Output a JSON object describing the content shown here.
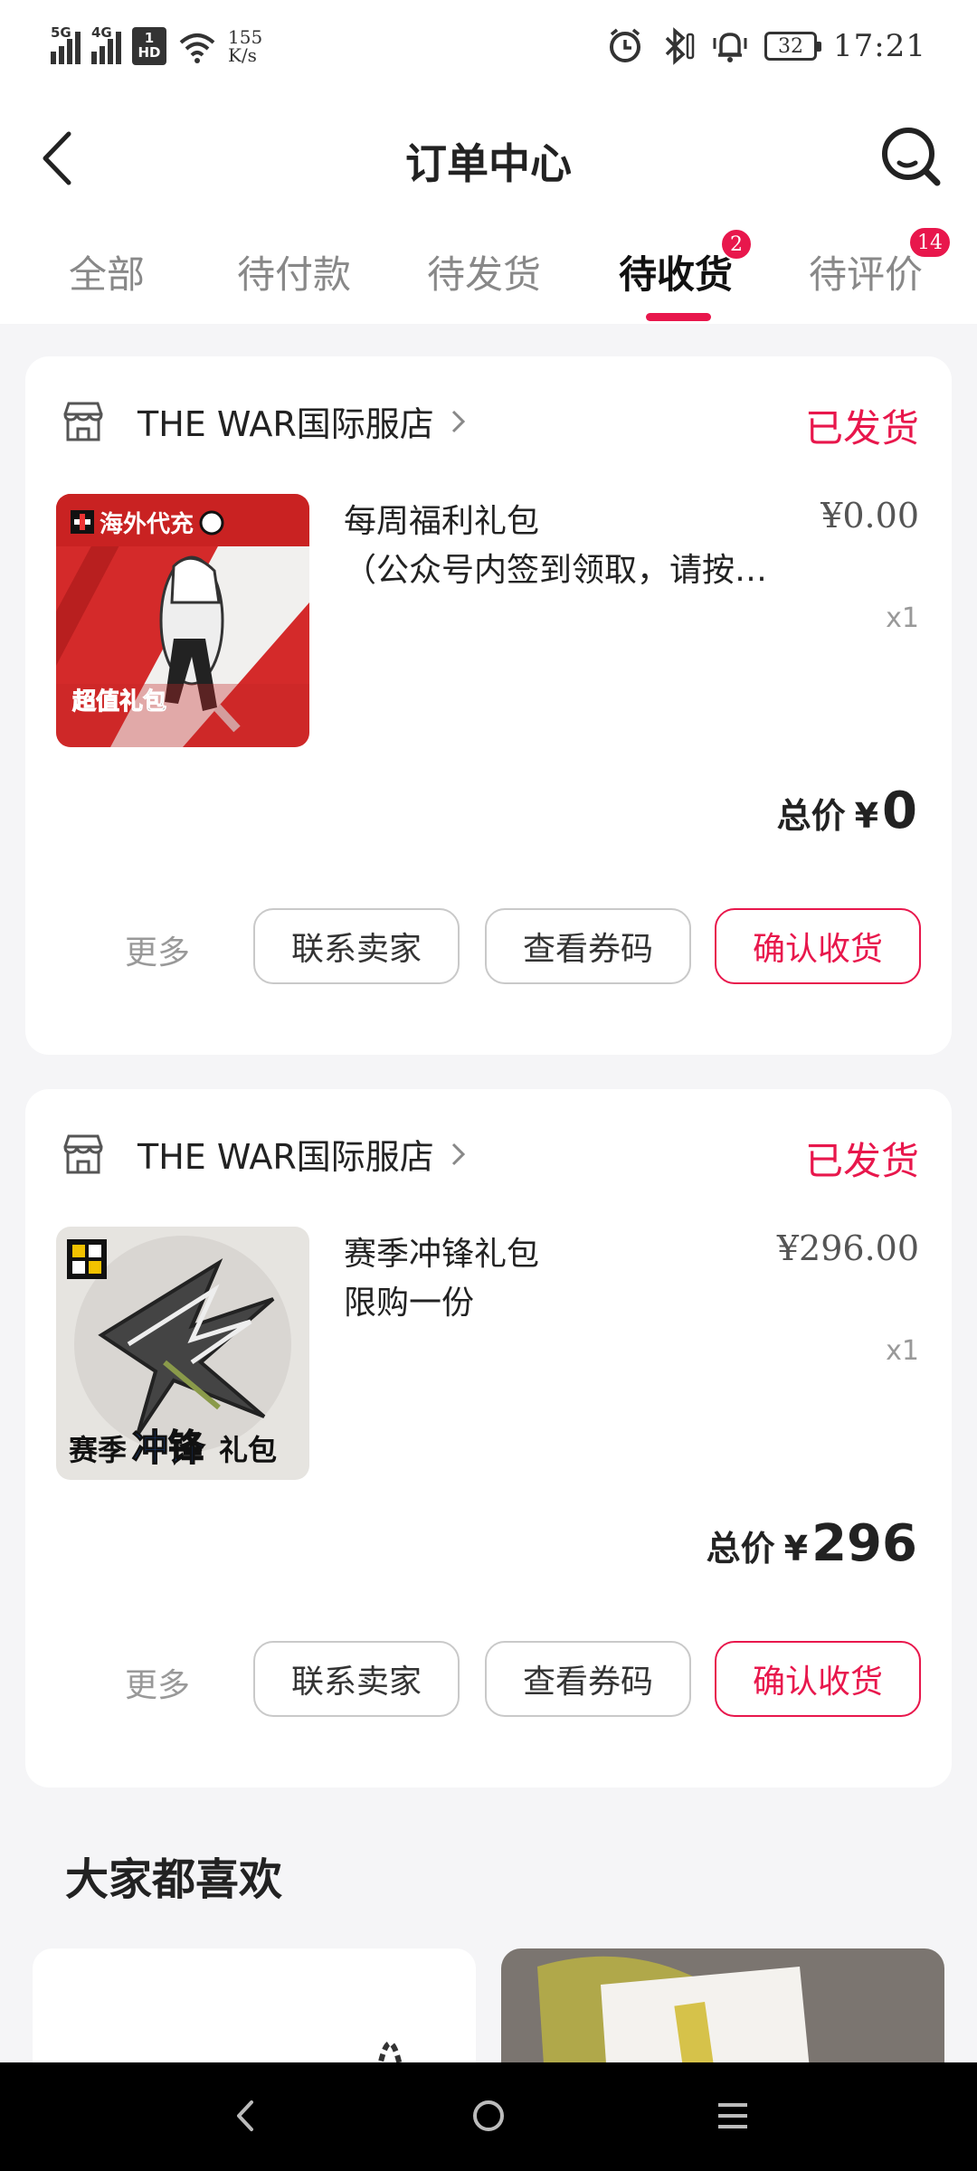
{
  "status_bar": {
    "signal_1": "5G",
    "signal_2": "4G",
    "hd_top": "1",
    "hd_bottom": "HD",
    "speed_value": "155",
    "speed_unit": "K/s",
    "battery": "32",
    "time": "17:21"
  },
  "nav": {
    "title": "订单中心"
  },
  "tabs": [
    {
      "label": "全部"
    },
    {
      "label": "待付款"
    },
    {
      "label": "待发货"
    },
    {
      "label": "待收货",
      "badge": "2"
    },
    {
      "label": "待评价",
      "badge": "14"
    }
  ],
  "orders": [
    {
      "store": "THE WAR国际服店",
      "status": "已发货",
      "title_line1": "每周福利礼包",
      "title_line2": "（公众号内签到领取，请按要求填写收货信息）",
      "price": "¥0.00",
      "qty": "x1",
      "total_label": "总价",
      "total_currency": "¥",
      "total_value": "0",
      "thumb_text_top": "海外代充",
      "thumb_text_bottom": "超值礼包",
      "more": "更多",
      "btn_contact": "联系卖家",
      "btn_code": "查看券码",
      "btn_confirm": "确认收货"
    },
    {
      "store": "THE WAR国际服店",
      "status": "已发货",
      "title_line1": "赛季冲锋礼包",
      "title_line2": "限购一份",
      "price": "¥296.00",
      "qty": "x1",
      "total_label": "总价",
      "total_currency": "¥",
      "total_value": "296",
      "thumb_text_a": "赛季",
      "thumb_text_b": "冲锋",
      "thumb_text_c": "礼包",
      "more": "更多",
      "btn_contact": "联系卖家",
      "btn_code": "查看券码",
      "btn_confirm": "确认收货"
    }
  ],
  "recommend": {
    "title": "大家都喜欢"
  },
  "colors": {
    "accent": "#e8174c",
    "background": "#f5f5f7"
  }
}
